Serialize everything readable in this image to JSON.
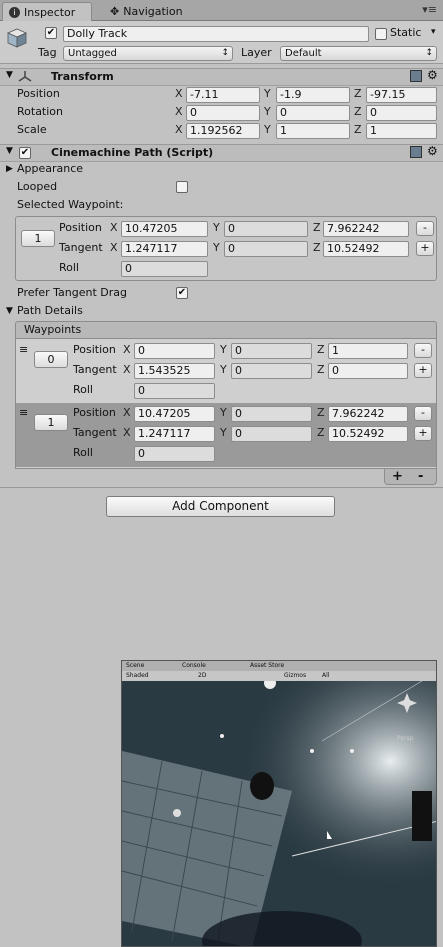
{
  "tabs": {
    "inspector": "Inspector",
    "navigation": "Navigation"
  },
  "object": {
    "name": "Dolly Track",
    "static_label": "Static",
    "tag_label": "Tag",
    "tag_value": "Untagged",
    "layer_label": "Layer",
    "layer_value": "Default"
  },
  "transform": {
    "title": "Transform",
    "rows": [
      {
        "label": "Position",
        "x": "-7.11",
        "y": "-1.9",
        "z": "-97.15"
      },
      {
        "label": "Rotation",
        "x": "0",
        "y": "0",
        "z": "0"
      },
      {
        "label": "Scale",
        "x": "1.192562",
        "y": "1",
        "z": "1"
      }
    ]
  },
  "axes": {
    "x": "X",
    "y": "Y",
    "z": "Z"
  },
  "path": {
    "title": "Cinemachine Path (Script)",
    "appearance": "Appearance",
    "looped": "Looped",
    "selected_waypoint": "Selected Waypoint:",
    "selected": {
      "index": "1",
      "position_label": "Position",
      "tangent_label": "Tangent",
      "roll_label": "Roll",
      "position": {
        "x": "10.47205",
        "y": "0",
        "z": "7.962242"
      },
      "tangent": {
        "x": "1.247117",
        "y": "0",
        "z": "10.52492"
      },
      "roll": "0"
    },
    "prefer_tangent_drag": "Prefer Tangent Drag",
    "path_details": "Path Details",
    "waypoints_header": "Waypoints",
    "waypoints": [
      {
        "index": "0",
        "position_label": "Position",
        "tangent_label": "Tangent",
        "roll_label": "Roll",
        "position": {
          "x": "0",
          "y": "0",
          "z": "1"
        },
        "tangent": {
          "x": "1.543525",
          "y": "0",
          "z": "0"
        },
        "roll": "0"
      },
      {
        "index": "1",
        "position_label": "Position",
        "tangent_label": "Tangent",
        "roll_label": "Roll",
        "position": {
          "x": "10.47205",
          "y": "0",
          "z": "7.962242"
        },
        "tangent": {
          "x": "1.247117",
          "y": "0",
          "z": "10.52492"
        },
        "roll": "0"
      }
    ],
    "minus": "-",
    "plus": "+"
  },
  "add_component": "Add Component",
  "scene_thumb": {
    "tab_scene": "Scene",
    "tab_console": "Console",
    "tab_asset_store": "Asset Store",
    "shaded": "Shaded",
    "mode_2d": "2D",
    "gizmos": "Gizmos",
    "search": "All",
    "persp": "Persp"
  },
  "colors": {
    "panel_bg": "#c2c2c2",
    "selected_waypoint_bg": "#9a9a9a",
    "scene_bg": "#203038"
  }
}
